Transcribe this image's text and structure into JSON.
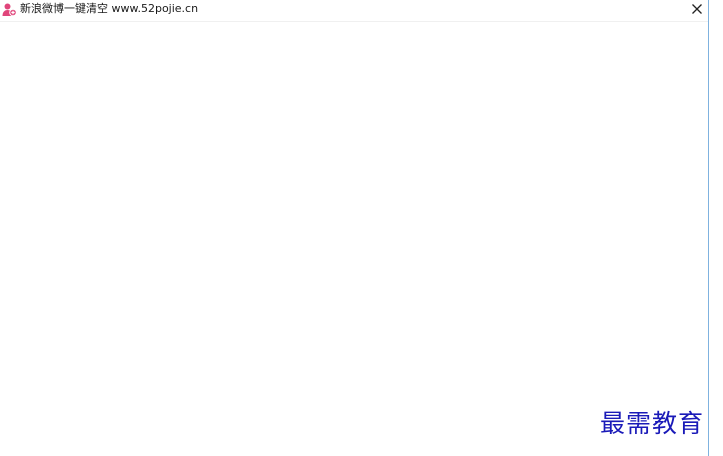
{
  "window": {
    "title": "新浪微博一键清空 www.52pojie.cn",
    "icon": "weibo-user-icon",
    "close_icon": "close-icon"
  },
  "watermark": {
    "text": "最需教育"
  },
  "colors": {
    "icon_pink": "#e0457b",
    "watermark_blue": "#1a1ab8",
    "window_border": "#7fb2df"
  }
}
